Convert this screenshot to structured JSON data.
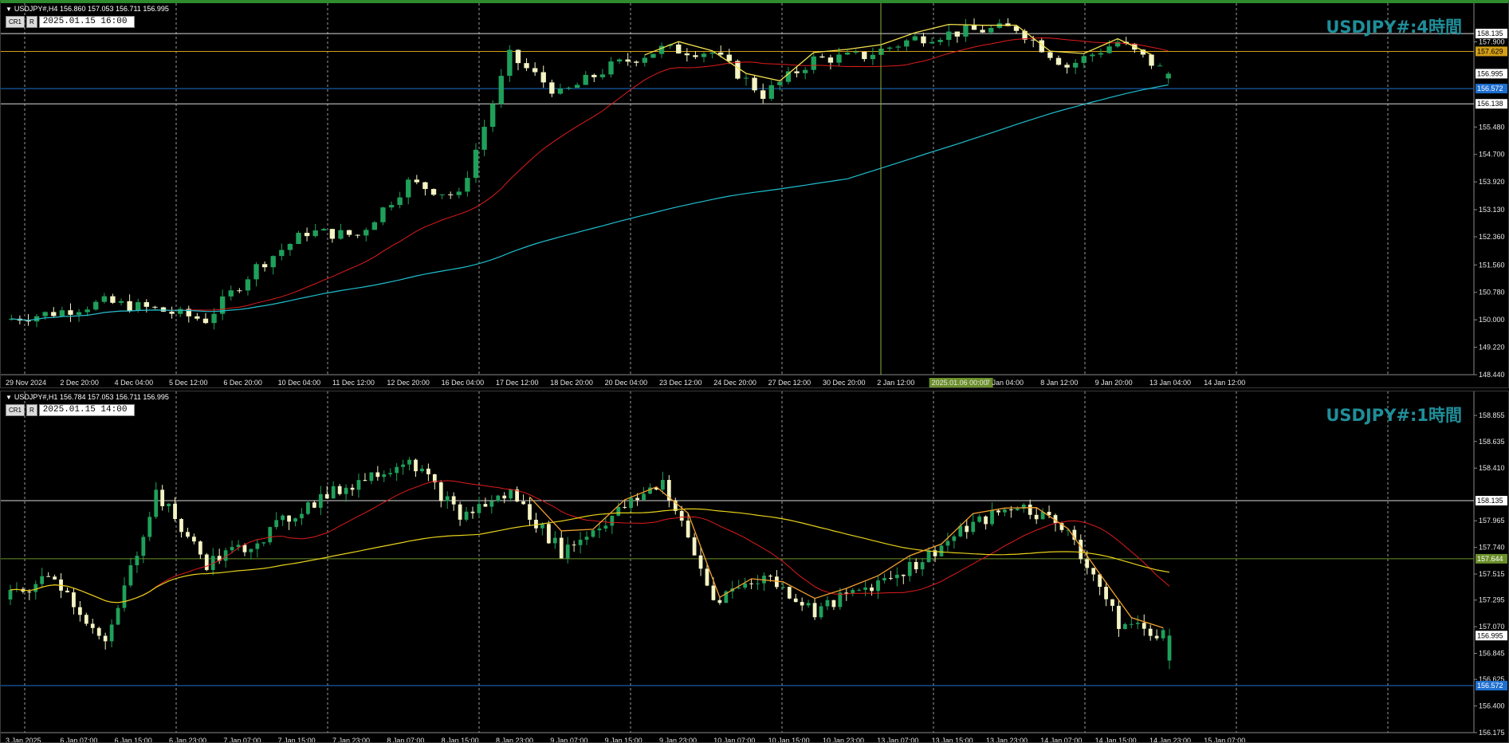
{
  "panes": [
    {
      "id": "h4",
      "info": "USDJPY#,H4  156.860 157.053 156.711 156.995",
      "toolbar": {
        "btn1": "CR1",
        "btn2": "R",
        "date": "2025.01.15 16:00"
      },
      "title": "USDJPY#:4時間",
      "price_ticks": [
        "158.135",
        "157.900",
        "157.629",
        "156.995",
        "156.572",
        "156.138",
        "155.480",
        "154.700",
        "153.920",
        "153.130",
        "152.360",
        "151.560",
        "150.780",
        "150.000",
        "149.220",
        "148.440"
      ],
      "highlighted_ticks": [
        {
          "label": "157.629",
          "color": "#d4a017",
          "text_color": "#000000"
        },
        {
          "label": "156.572",
          "color": "#1e6fd0",
          "text_color": "#ffffff"
        },
        {
          "label": "156.995",
          "color": "#ffffff",
          "text_color": "#000000"
        },
        {
          "label": "158.135",
          "color": "#ffffff",
          "text_color": "#000000"
        },
        {
          "label": "156.138",
          "color": "#ffffff",
          "text_color": "#000000"
        }
      ],
      "time_ticks": [
        "29 Nov 2024",
        "2 Dec 20:00",
        "4 Dec 04:00",
        "5 Dec 12:00",
        "6 Dec 20:00",
        "10 Dec 04:00",
        "11 Dec 12:00",
        "12 Dec 20:00",
        "16 Dec 04:00",
        "17 Dec 12:00",
        "18 Dec 20:00",
        "20 Dec 04:00",
        "23 Dec 12:00",
        "24 Dec 20:00",
        "27 Dec 12:00",
        "30 Dec 20:00",
        "2 Jan 12:00",
        "2025.01.06 00:00",
        "7 Jan 04:00",
        "8 Jan 12:00",
        "9 Jan 20:00",
        "13 Jan 04:00",
        "14 Jan 12:00"
      ],
      "crosshair_time": "2025.01.06 00:00",
      "colors": {
        "ma_fast": "#e01b1b",
        "ma_slow": "#1fbfcf",
        "zigzag": "#f4e04d",
        "up": "#1fa05a",
        "down": "#f4f4c4"
      }
    },
    {
      "id": "h1",
      "info": "USDJPY#,H1  156.784 157.053 156.711 156.995",
      "toolbar": {
        "btn1": "CR1",
        "btn2": "R",
        "date": "2025.01.15 14:00"
      },
      "title": "USDJPY#:1時間",
      "price_ticks": [
        "158.855",
        "158.635",
        "158.410",
        "158.135",
        "157.965",
        "157.740",
        "157.644",
        "157.515",
        "157.295",
        "157.070",
        "156.995",
        "156.845",
        "156.625",
        "156.572",
        "156.400",
        "156.175"
      ],
      "highlighted_ticks": [
        {
          "label": "157.644",
          "color": "#6b8f2a",
          "text_color": "#ffffff"
        },
        {
          "label": "156.572",
          "color": "#1e6fd0",
          "text_color": "#ffffff"
        },
        {
          "label": "158.135",
          "color": "#ffffff",
          "text_color": "#000000"
        },
        {
          "label": "156.995",
          "color": "#ffffff",
          "text_color": "#000000"
        }
      ],
      "time_ticks": [
        "3 Jan 2025",
        "6 Jan 07:00",
        "6 Jan 15:00",
        "6 Jan 23:00",
        "7 Jan 07:00",
        "7 Jan 15:00",
        "7 Jan 23:00",
        "8 Jan 07:00",
        "8 Jan 15:00",
        "8 Jan 23:00",
        "9 Jan 07:00",
        "9 Jan 15:00",
        "9 Jan 23:00",
        "10 Jan 07:00",
        "10 Jan 15:00",
        "10 Jan 23:00",
        "13 Jan 07:00",
        "13 Jan 15:00",
        "13 Jan 23:00",
        "14 Jan 07:00",
        "14 Jan 15:00",
        "14 Jan 23:00",
        "15 Jan 07:00"
      ],
      "colors": {
        "ma_fast": "#e01b1b",
        "ma_slow": "#e8d21a",
        "zigzag": "#f0a030",
        "up": "#1fa05a",
        "down": "#f4f4c4"
      }
    }
  ],
  "chart_data": [
    {
      "type": "candlestick",
      "title": "USDJPY#:4時間",
      "symbol": "USDJPY#",
      "timeframe": "H4",
      "ohlc_last": {
        "open": 156.86,
        "high": 157.053,
        "low": 156.711,
        "close": 156.995
      },
      "ylim": [
        148.44,
        158.5
      ],
      "horizontal_levels": [
        158.135,
        157.629,
        156.572,
        156.138
      ],
      "close_path": [
        [
          "29 Nov 2024",
          150.0
        ],
        [
          "2 Dec 20:00",
          150.2
        ],
        [
          "4 Dec 04:00",
          150.5
        ],
        [
          "5 Dec 12:00",
          150.3
        ],
        [
          "6 Dec 20:00",
          150.0
        ],
        [
          "10 Dec 04:00",
          151.5
        ],
        [
          "11 Dec 12:00",
          152.5
        ],
        [
          "12 Dec 20:00",
          152.4
        ],
        [
          "16 Dec 04:00",
          153.9
        ],
        [
          "17 Dec 12:00",
          153.5
        ],
        [
          "18 Dec 20:00",
          157.5
        ],
        [
          "20 Dec 04:00",
          156.4
        ],
        [
          "23 Dec 12:00",
          157.2
        ],
        [
          "24 Dec 20:00",
          157.7
        ],
        [
          "27 Dec 12:00",
          157.6
        ],
        [
          "30 Dec 20:00",
          156.4
        ],
        [
          "2 Jan 12:00",
          157.4
        ],
        [
          "2025.01.06 00:00",
          157.5
        ],
        [
          "7 Jan 04:00",
          158.0
        ],
        [
          "8 Jan 12:00",
          158.2
        ],
        [
          "9 Jan 20:00",
          158.3
        ],
        [
          "13 Jan 04:00",
          157.2
        ],
        [
          "14 Jan 12:00",
          157.9
        ],
        [
          "15 Jan 16:00",
          156.995
        ]
      ]
    },
    {
      "type": "candlestick",
      "title": "USDJPY#:1時間",
      "symbol": "USDJPY#",
      "timeframe": "H1",
      "ohlc_last": {
        "open": 156.784,
        "high": 157.053,
        "low": 156.711,
        "close": 156.995
      },
      "ylim": [
        156.175,
        158.95
      ],
      "horizontal_levels": [
        158.135,
        157.644,
        156.572
      ],
      "close_path": [
        [
          "3 Jan 2025",
          157.3
        ],
        [
          "6 Jan 07:00",
          157.5
        ],
        [
          "6 Jan 15:00",
          156.9
        ],
        [
          "6 Jan 23:00",
          158.2
        ],
        [
          "7 Jan 07:00",
          157.6
        ],
        [
          "7 Jan 15:00",
          157.8
        ],
        [
          "7 Jan 23:00",
          158.1
        ],
        [
          "8 Jan 07:00",
          158.3
        ],
        [
          "8 Jan 15:00",
          158.5
        ],
        [
          "8 Jan 23:00",
          158.0
        ],
        [
          "9 Jan 07:00",
          158.2
        ],
        [
          "9 Jan 15:00",
          157.7
        ],
        [
          "9 Jan 23:00",
          158.0
        ],
        [
          "10 Jan 07:00",
          158.3
        ],
        [
          "10 Jan 15:00",
          157.3
        ],
        [
          "10 Jan 23:00",
          157.5
        ],
        [
          "13 Jan 07:00",
          157.2
        ],
        [
          "13 Jan 15:00",
          157.4
        ],
        [
          "13 Jan 23:00",
          157.6
        ],
        [
          "14 Jan 07:00",
          157.9
        ],
        [
          "14 Jan 15:00",
          158.1
        ],
        [
          "14 Jan 23:00",
          157.9
        ],
        [
          "15 Jan 07:00",
          157.1
        ],
        [
          "15 Jan 14:00",
          156.995
        ]
      ]
    }
  ]
}
